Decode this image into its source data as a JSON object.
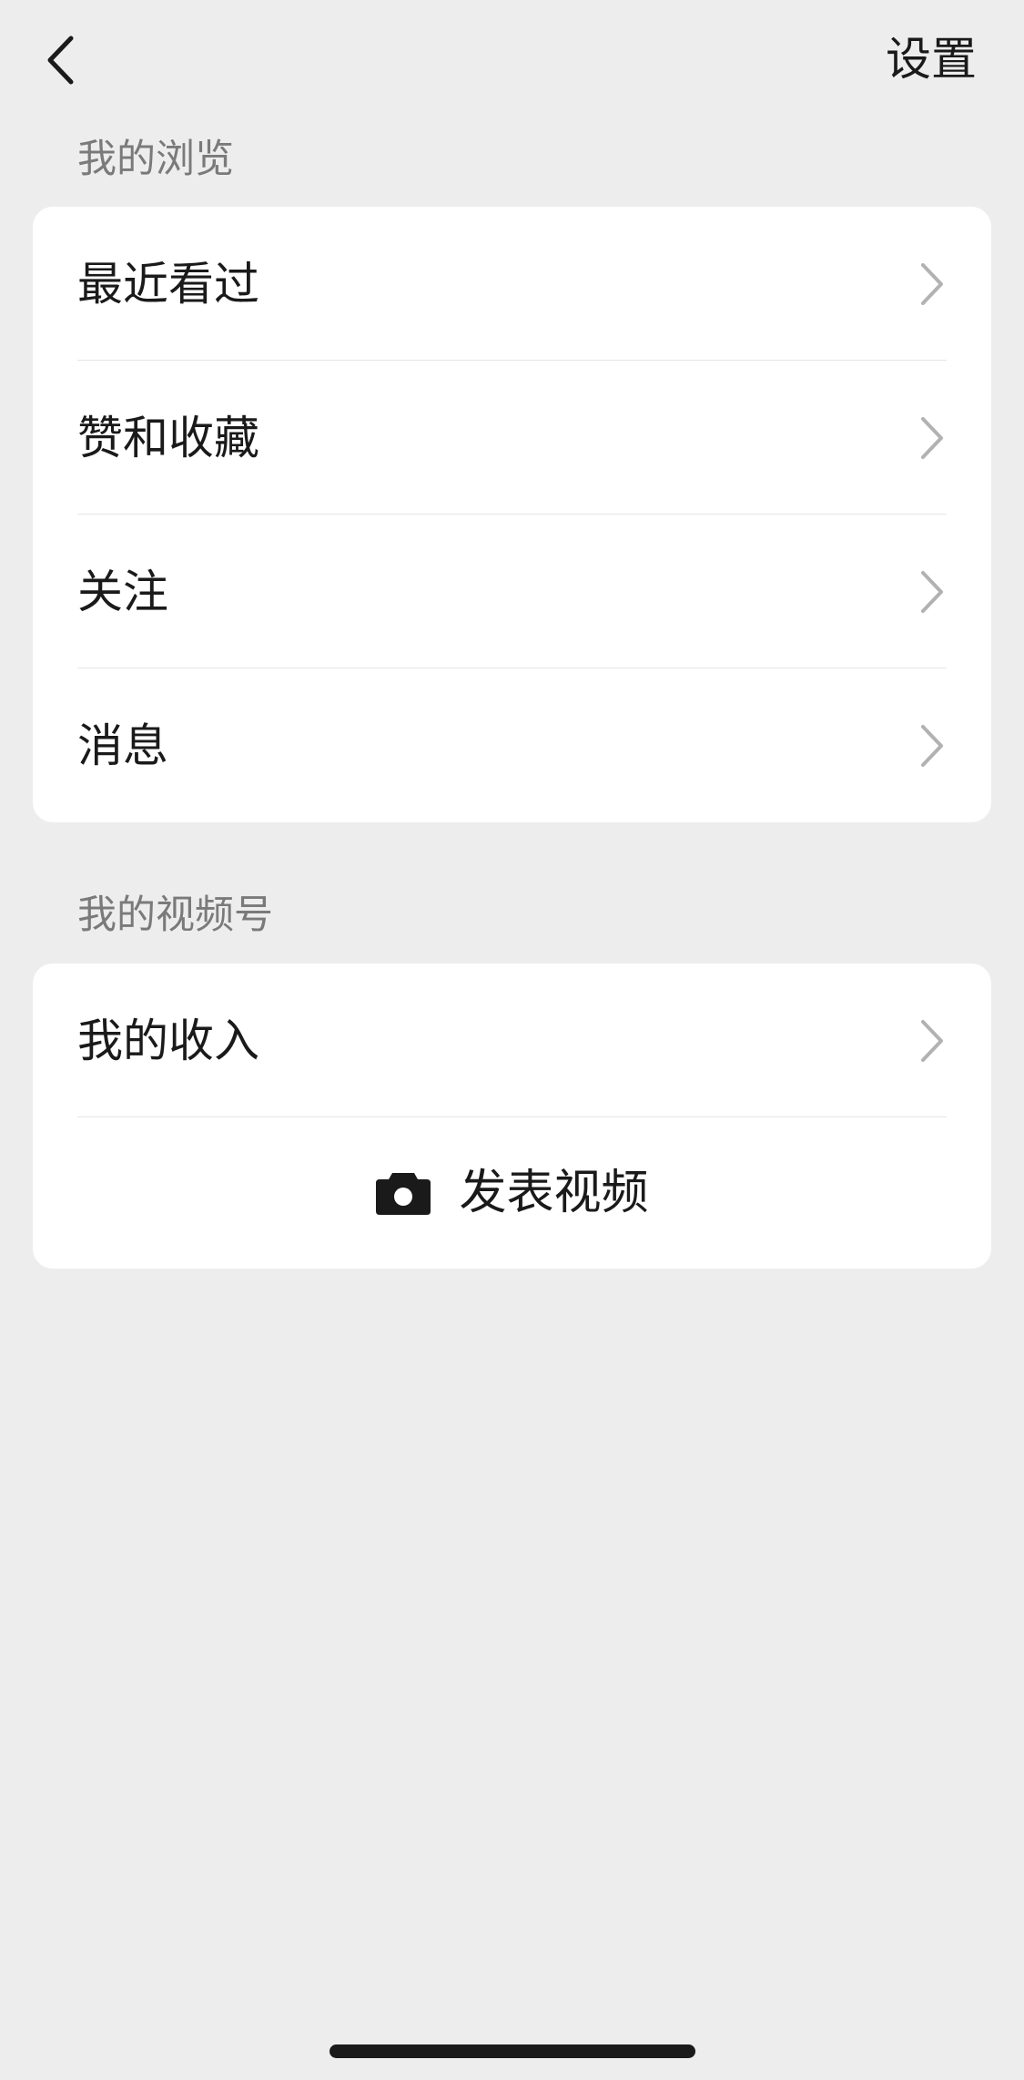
{
  "header": {
    "back_icon": "chevron-left-icon",
    "settings_label": "设置"
  },
  "browse_section": {
    "title": "我的浏览",
    "items": [
      {
        "label": "最近看过",
        "icon": "chevron-right-icon"
      },
      {
        "label": "赞和收藏",
        "icon": "chevron-right-icon"
      },
      {
        "label": "关注",
        "icon": "chevron-right-icon"
      },
      {
        "label": "消息",
        "icon": "chevron-right-icon"
      }
    ]
  },
  "channel_section": {
    "title": "我的视频号",
    "items": [
      {
        "label": "我的收入",
        "icon": "chevron-right-icon"
      }
    ],
    "publish": {
      "label": "发表视频",
      "icon": "camera-icon"
    }
  },
  "colors": {
    "background": "#ededed",
    "card": "#ffffff",
    "text_primary": "#1a1a1a",
    "text_secondary": "#7a7a7a",
    "chevron": "#b2b2b2"
  }
}
